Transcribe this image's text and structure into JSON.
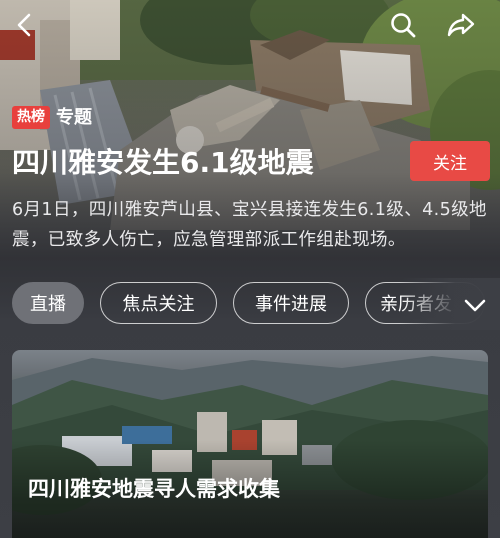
{
  "topbar": {
    "back_icon": "chevron-left-icon",
    "search_icon": "search-icon",
    "share_icon": "share-icon"
  },
  "header": {
    "hot_badge": "热榜",
    "topic_label": "专题",
    "title": "四川雅安发生6.1级地震",
    "follow_label": "关注",
    "description": "6月1日，四川雅安芦山县、宝兴县接连发生6.1级、4.5级地震，已致多人伤亡，应急管理部派工作组赴现场。"
  },
  "tabs": [
    {
      "label": "直播",
      "active": true
    },
    {
      "label": "焦点关注",
      "active": false
    },
    {
      "label": "事件进展",
      "active": false
    },
    {
      "label": "亲历者发",
      "active": false
    }
  ],
  "card": {
    "title": "四川雅安地震寻人需求收集"
  },
  "colors": {
    "accent": "#e84a45",
    "hot_badge": "#e8403d",
    "active_tab": "#6f7177"
  }
}
